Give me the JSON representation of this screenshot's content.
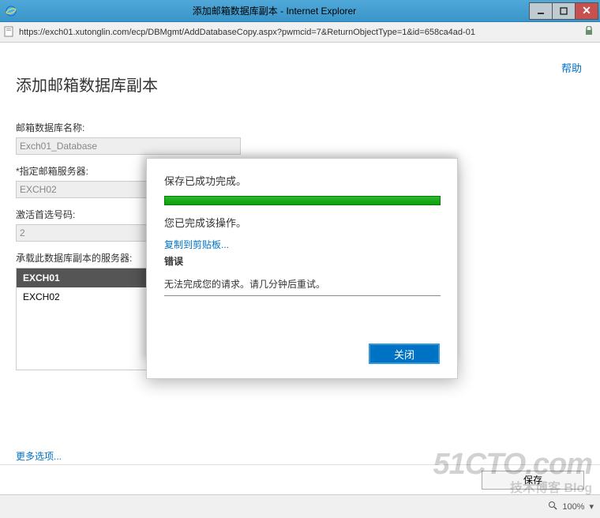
{
  "window": {
    "title": "添加邮箱数据库副本 - Internet Explorer",
    "url": "https://exch01.xutonglin.com/ecp/DBMgmt/AddDatabaseCopy.aspx?pwmcid=7&ReturnObjectType=1&id=658ca4ad-01"
  },
  "page": {
    "help": "帮助",
    "title": "添加邮箱数据库副本",
    "dbname_label": "邮箱数据库名称:",
    "dbname_value": "Exch01_Database",
    "server_label": "*指定邮箱服务器:",
    "server_value": "EXCH02",
    "actpref_label": "激活首选号码:",
    "actpref_value": "2",
    "copyservers_label": "承载此数据库副本的服务器:",
    "servers": [
      "EXCH01",
      "EXCH02"
    ],
    "more": "更多选项...",
    "save": "保存"
  },
  "dialog": {
    "msg": "保存已成功完成。",
    "done": "您已完成该操作。",
    "copy_link": "复制到剪贴板...",
    "err_label": "错误",
    "err_text": "无法完成您的请求。请几分钟后重试。",
    "close": "关闭"
  },
  "status": {
    "zoom": "100%"
  },
  "watermark": {
    "main": "51CTO.com",
    "sub": "技术博客  Blog"
  }
}
